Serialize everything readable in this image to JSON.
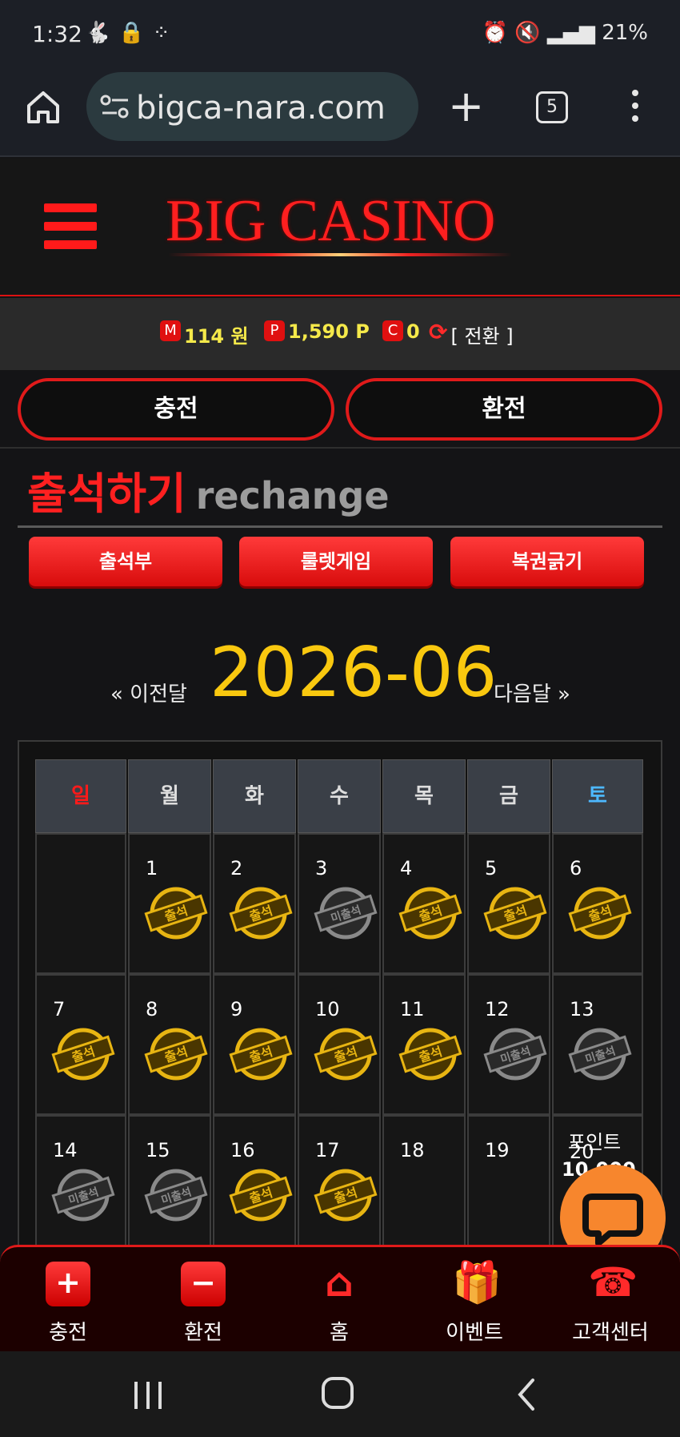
{
  "status_bar": {
    "time": "1:32",
    "battery": "21%"
  },
  "browser": {
    "url": "bigca-nara.com",
    "tab_count": "5"
  },
  "header": {
    "logo": "BIG CASINO"
  },
  "balance": {
    "money_badge": "M",
    "money": "114 원",
    "point_badge": "P",
    "points": "1,590 P",
    "coin_badge": "C",
    "coins": "0",
    "convert_label": "[ 전환 ]"
  },
  "actions": {
    "charge": "충전",
    "exchange": "환전"
  },
  "section": {
    "title_ko": "출석하기",
    "title_en": "rechange"
  },
  "tabs": [
    "출석부",
    "룰렛게임",
    "복권긁기"
  ],
  "month_nav": {
    "prev": "« 이전달",
    "current": "2026-06",
    "next": "다음달 »"
  },
  "calendar": {
    "weekdays": [
      "일",
      "월",
      "화",
      "수",
      "목",
      "금",
      "토"
    ],
    "weekday_colors": {
      "sunday": "#ff1a1a",
      "saturday": "#4db8ff",
      "default": "#dddddd"
    },
    "stamp_labels": {
      "attended": "출석",
      "missed": "미출석"
    },
    "weeks": [
      [
        {
          "day": "",
          "stamp": ""
        },
        {
          "day": "1",
          "stamp": "attended"
        },
        {
          "day": "2",
          "stamp": "attended"
        },
        {
          "day": "3",
          "stamp": "missed"
        },
        {
          "day": "4",
          "stamp": "attended"
        },
        {
          "day": "5",
          "stamp": "attended"
        },
        {
          "day": "6",
          "stamp": "attended"
        }
      ],
      [
        {
          "day": "7",
          "stamp": "attended"
        },
        {
          "day": "8",
          "stamp": "attended"
        },
        {
          "day": "9",
          "stamp": "attended"
        },
        {
          "day": "10",
          "stamp": "attended"
        },
        {
          "day": "11",
          "stamp": "attended"
        },
        {
          "day": "12",
          "stamp": "missed"
        },
        {
          "day": "13",
          "stamp": "missed"
        }
      ],
      [
        {
          "day": "14",
          "stamp": "missed"
        },
        {
          "day": "15",
          "stamp": "missed"
        },
        {
          "day": "16",
          "stamp": "attended"
        },
        {
          "day": "17",
          "stamp": "attended"
        },
        {
          "day": "18",
          "stamp": ""
        },
        {
          "day": "19",
          "stamp": ""
        },
        {
          "day": "20",
          "stamp": "",
          "bonus_label": "포인트",
          "bonus_value": "10,000"
        }
      ]
    ]
  },
  "footer_nav": [
    {
      "label": "충전",
      "icon": "plus-icon"
    },
    {
      "label": "환전",
      "icon": "minus-icon"
    },
    {
      "label": "홈",
      "icon": "home-icon"
    },
    {
      "label": "이벤트",
      "icon": "gift-icon"
    },
    {
      "label": "고객센터",
      "icon": "phone-24-icon"
    }
  ],
  "colors": {
    "accent_red": "#e01a1a",
    "gold": "#f9c80f",
    "chat_orange": "#f7862d"
  }
}
